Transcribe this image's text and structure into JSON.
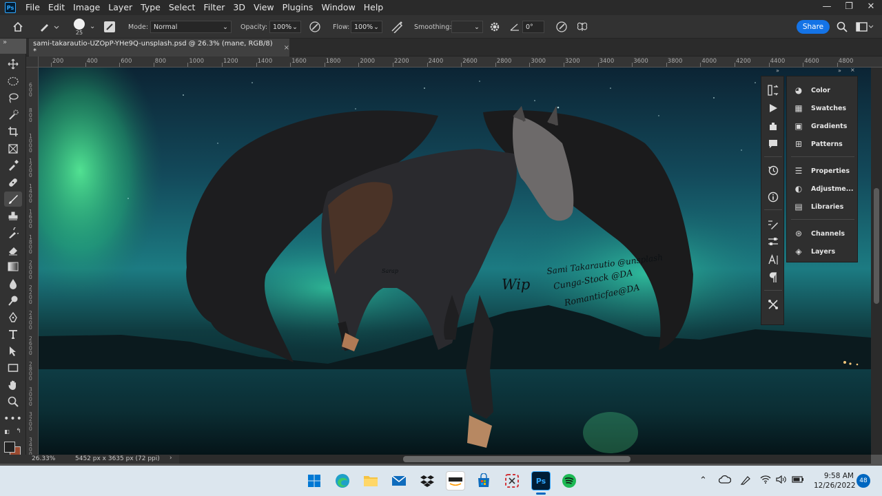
{
  "app": {
    "logo": "Ps",
    "menu": [
      "File",
      "Edit",
      "Image",
      "Layer",
      "Type",
      "Select",
      "Filter",
      "3D",
      "View",
      "Plugins",
      "Window",
      "Help"
    ],
    "window_controls": {
      "minimize": "—",
      "restore": "❐",
      "close": "✕"
    }
  },
  "options_bar": {
    "brush_size": "25",
    "mode_label": "Mode:",
    "mode_value": "Normal",
    "opacity_label": "Opacity:",
    "opacity_value": "100%",
    "flow_label": "Flow:",
    "flow_value": "100%",
    "smoothing_label": "Smoothing:",
    "smoothing_value": "",
    "angle_value": "0°",
    "share_label": "Share"
  },
  "document": {
    "tab_title": "sami-takarautio-UZOpP-YHe9Q-unsplash.psd @ 26.3% (mane, RGB/8) *",
    "tab_close": "×",
    "collapse": "»"
  },
  "ruler": {
    "h_labels": [
      "200",
      "400",
      "600",
      "800",
      "1000",
      "1200",
      "1400",
      "1600",
      "1800",
      "2000",
      "2200",
      "2400",
      "2600",
      "2800",
      "3000",
      "3200",
      "3400",
      "3600",
      "3800",
      "4000",
      "4200",
      "4400",
      "4600",
      "4800"
    ],
    "v_labels": [
      "600",
      "800",
      "1000",
      "1200",
      "1400",
      "1600",
      "1800",
      "2000",
      "2200",
      "2400",
      "2600",
      "2800",
      "3000",
      "3200",
      "3400"
    ]
  },
  "canvas_text": {
    "wip": "Wip",
    "credit_1": "Sami Takarautio @unsplash",
    "credit_2": "Cunga-Stock @DA",
    "credit_3": "Romanticfae@DA",
    "signature": "Sarap"
  },
  "status": {
    "zoom": "26.33%",
    "doc_size": "5452 px x 3635 px (72 ppi)",
    "arrow": "›"
  },
  "panels": {
    "header_left": "»",
    "header_right": "»",
    "header_close": "×",
    "items": [
      {
        "label": "Color",
        "icon": "color-palette-icon"
      },
      {
        "label": "Swatches",
        "icon": "swatches-grid-icon"
      },
      {
        "label": "Gradients",
        "icon": "gradient-icon"
      },
      {
        "label": "Patterns",
        "icon": "patterns-icon"
      },
      {
        "label": "Properties",
        "icon": "properties-sliders-icon"
      },
      {
        "label": "Adjustme...",
        "icon": "adjustments-icon"
      },
      {
        "label": "Libraries",
        "icon": "libraries-icon"
      },
      {
        "label": "Channels",
        "icon": "channels-icon"
      },
      {
        "label": "Layers",
        "icon": "layers-icon"
      }
    ]
  },
  "taskbar": {
    "time": "9:58 AM",
    "date": "12/26/2022",
    "notifications": "48",
    "apps": [
      "windows-start",
      "edge",
      "file-explorer",
      "mail",
      "dropbox",
      "amazon",
      "microsoft-store",
      "snipping-tool",
      "photoshop",
      "spotify"
    ]
  },
  "colors": {
    "accent": "#1473e6",
    "foreground_swatch": "#222222",
    "background_swatch": "#9b4a30",
    "taskbar": "#dce6ee"
  }
}
